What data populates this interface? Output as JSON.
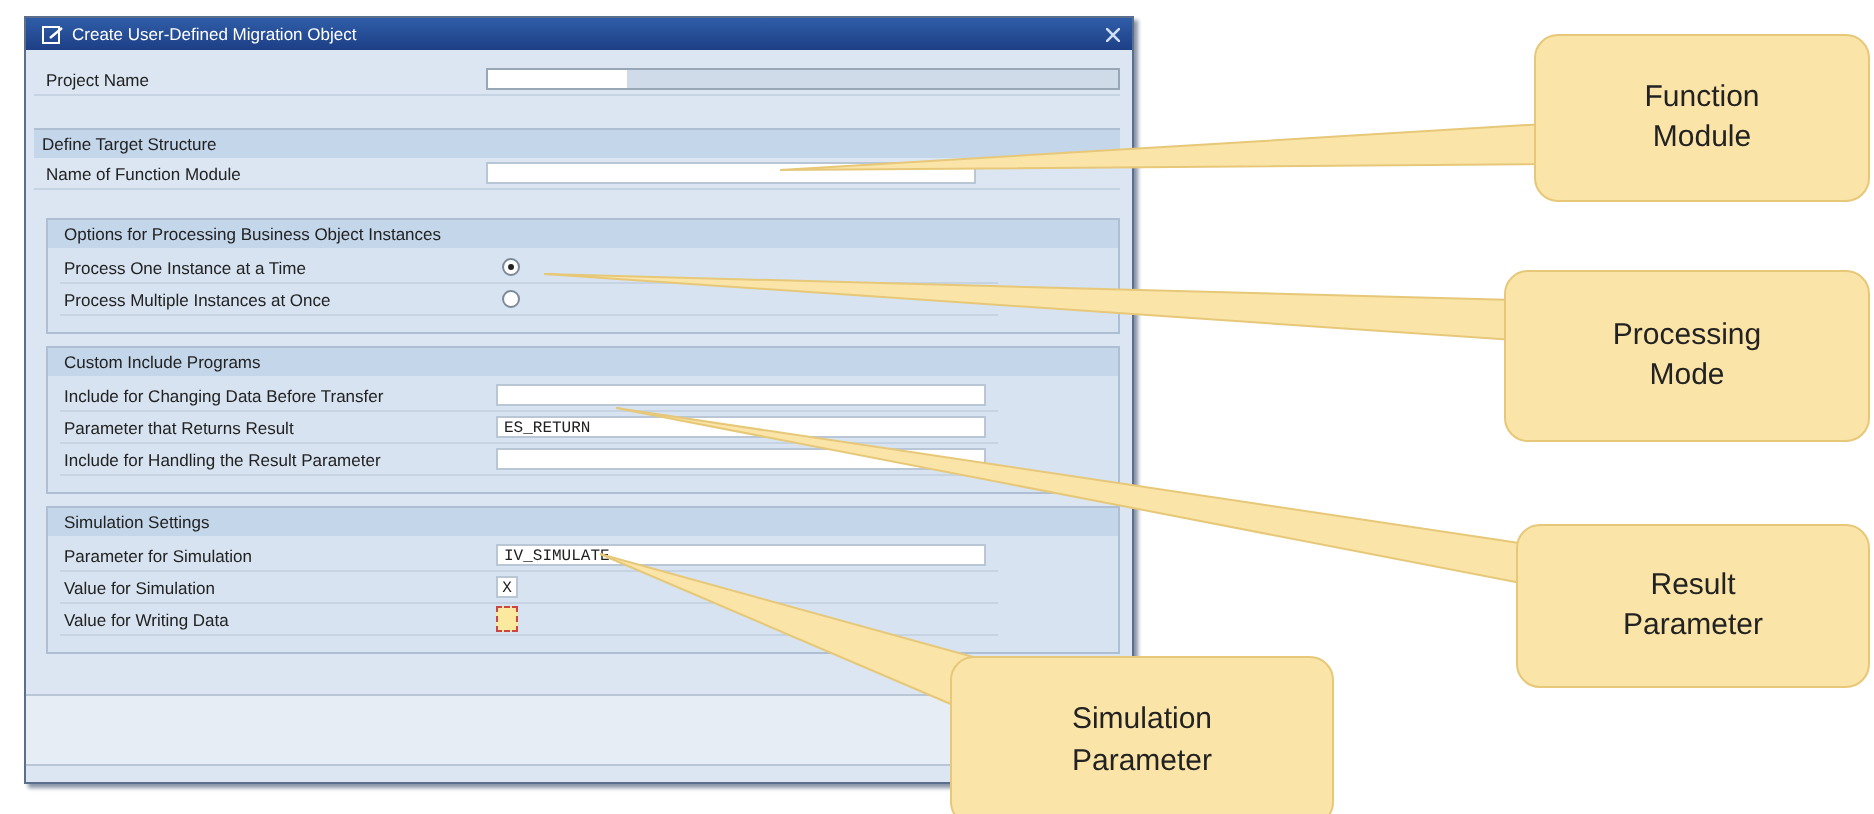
{
  "window": {
    "title": "Create User-Defined Migration Object"
  },
  "project": {
    "label": "Project Name"
  },
  "sections": [
    {
      "kind": "bar",
      "title": "Define Target Structure",
      "rows": [
        {
          "kind": "field",
          "label": "Name of Function Module"
        }
      ]
    },
    {
      "kind": "group",
      "title": "Options for Processing Business Object Instances",
      "rows": [
        {
          "kind": "radio",
          "label": "Process One Instance at a Time",
          "selected": true
        },
        {
          "kind": "radio",
          "label": "Process Multiple Instances at Once",
          "selected": false
        }
      ]
    },
    {
      "kind": "group",
      "title": "Custom Include Programs",
      "rows": [
        {
          "kind": "field",
          "label": "Include for Changing Data Before Transfer"
        },
        {
          "kind": "field",
          "label": "Parameter that Returns Result",
          "value": "ES_RETURN"
        },
        {
          "kind": "field",
          "label": "Include for Handling the Result Parameter"
        }
      ]
    },
    {
      "kind": "group",
      "title": "Simulation Settings",
      "rows": [
        {
          "kind": "field",
          "label": "Parameter for Simulation",
          "value": "IV_SIMULATE"
        },
        {
          "kind": "flag",
          "label": "Value for Simulation",
          "value": "X",
          "focused": false
        },
        {
          "kind": "flag",
          "label": "Value for Writing Data",
          "focused": true
        }
      ]
    }
  ],
  "callouts": [
    {
      "text": "Function Module"
    },
    {
      "text": "Processing Mode"
    },
    {
      "text": "Result Parameter"
    },
    {
      "text": "Simulation Parameter"
    }
  ]
}
